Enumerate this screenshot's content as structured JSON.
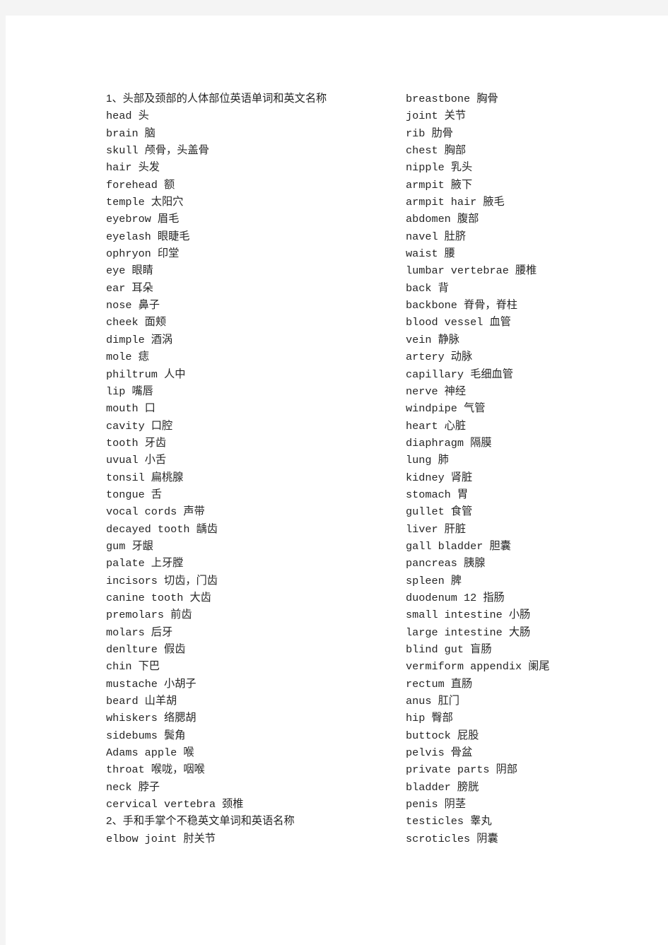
{
  "document": {
    "page_background": "#f4f4f4",
    "sheet_background": "#ffffff",
    "text_color": "#252525",
    "left_column": [
      {
        "type": "heading",
        "text": "1、头部及颈部的人体部位英语单词和英文名称"
      },
      {
        "type": "entry",
        "text": "head 头"
      },
      {
        "type": "entry",
        "text": "brain 脑"
      },
      {
        "type": "entry",
        "text": "skull 颅骨，头盖骨"
      },
      {
        "type": "entry",
        "text": "hair 头发"
      },
      {
        "type": "entry",
        "text": "forehead 额"
      },
      {
        "type": "entry",
        "text": "temple 太阳穴"
      },
      {
        "type": "entry",
        "text": "eyebrow 眉毛"
      },
      {
        "type": "entry",
        "text": "eyelash 眼睫毛"
      },
      {
        "type": "entry",
        "text": "ophryon 印堂"
      },
      {
        "type": "entry",
        "text": "eye 眼睛"
      },
      {
        "type": "entry",
        "text": "ear 耳朵"
      },
      {
        "type": "entry",
        "text": "nose 鼻子"
      },
      {
        "type": "entry",
        "text": "cheek 面颊"
      },
      {
        "type": "entry",
        "text": "dimple 酒涡"
      },
      {
        "type": "entry",
        "text": "mole 痣"
      },
      {
        "type": "entry",
        "text": "philtrum 人中"
      },
      {
        "type": "entry",
        "text": "lip 嘴唇"
      },
      {
        "type": "entry",
        "text": "mouth 口"
      },
      {
        "type": "entry",
        "text": "cavity 口腔"
      },
      {
        "type": "entry",
        "text": "tooth 牙齿"
      },
      {
        "type": "entry",
        "text": "uvual 小舌"
      },
      {
        "type": "entry",
        "text": "tonsil 扁桃腺"
      },
      {
        "type": "entry",
        "text": "tongue 舌"
      },
      {
        "type": "entry",
        "text": "vocal cords 声带"
      },
      {
        "type": "entry",
        "text": "decayed tooth 龋齿"
      },
      {
        "type": "entry",
        "text": "gum 牙龈"
      },
      {
        "type": "entry",
        "text": "palate 上牙膛"
      },
      {
        "type": "entry",
        "text": "incisors 切齿，门齿"
      },
      {
        "type": "entry",
        "text": "canine tooth 大齿"
      },
      {
        "type": "entry",
        "text": "premolars 前齿"
      },
      {
        "type": "entry",
        "text": "molars 后牙"
      },
      {
        "type": "entry",
        "text": "denlture 假齿"
      },
      {
        "type": "entry",
        "text": "chin 下巴"
      },
      {
        "type": "entry",
        "text": "mustache 小胡子"
      },
      {
        "type": "entry",
        "text": "beard 山羊胡"
      },
      {
        "type": "entry",
        "text": "whiskers 络腮胡"
      },
      {
        "type": "entry",
        "text": "sidebums 鬓角"
      },
      {
        "type": "entry",
        "text": "Adams apple 喉"
      },
      {
        "type": "entry",
        "text": "throat 喉咙，咽喉"
      },
      {
        "type": "entry",
        "text": "neck 脖子"
      },
      {
        "type": "entry",
        "text": "cervical vertebra 颈椎"
      },
      {
        "type": "heading",
        "text": "2、手和手掌个不稳英文单词和英语名称"
      },
      {
        "type": "entry",
        "text": "elbow joint 肘关节"
      }
    ],
    "right_column": [
      {
        "type": "entry",
        "text": "breastbone 胸骨"
      },
      {
        "type": "entry",
        "text": "joint 关节"
      },
      {
        "type": "entry",
        "text": "rib 肋骨"
      },
      {
        "type": "entry",
        "text": "chest 胸部"
      },
      {
        "type": "entry",
        "text": "nipple 乳头"
      },
      {
        "type": "entry",
        "text": "armpit 腋下"
      },
      {
        "type": "entry",
        "text": "armpit hair 腋毛"
      },
      {
        "type": "entry",
        "text": "abdomen 腹部"
      },
      {
        "type": "entry",
        "text": "navel 肚脐"
      },
      {
        "type": "entry",
        "text": "waist 腰"
      },
      {
        "type": "entry",
        "text": "lumbar vertebrae 腰椎"
      },
      {
        "type": "entry",
        "text": "back 背"
      },
      {
        "type": "entry",
        "text": "backbone 脊骨，脊柱"
      },
      {
        "type": "entry",
        "text": "blood vessel 血管"
      },
      {
        "type": "entry",
        "text": "vein 静脉"
      },
      {
        "type": "entry",
        "text": "artery 动脉"
      },
      {
        "type": "entry",
        "text": "capillary 毛细血管"
      },
      {
        "type": "entry",
        "text": "nerve 神经"
      },
      {
        "type": "entry",
        "text": "windpipe 气管"
      },
      {
        "type": "entry",
        "text": "heart 心脏"
      },
      {
        "type": "entry",
        "text": "diaphragm 隔膜"
      },
      {
        "type": "entry",
        "text": "lung 肺"
      },
      {
        "type": "entry",
        "text": "kidney 肾脏"
      },
      {
        "type": "entry",
        "text": "stomach 胃"
      },
      {
        "type": "entry",
        "text": "gullet 食管"
      },
      {
        "type": "entry",
        "text": "liver 肝脏"
      },
      {
        "type": "entry",
        "text": "gall bladder 胆囊"
      },
      {
        "type": "entry",
        "text": "pancreas 胰腺"
      },
      {
        "type": "entry",
        "text": "spleen 脾"
      },
      {
        "type": "entry",
        "text": "duodenum 12 指肠"
      },
      {
        "type": "entry",
        "text": "small intestine 小肠"
      },
      {
        "type": "entry",
        "text": "large intestine 大肠"
      },
      {
        "type": "entry",
        "text": "blind gut 盲肠"
      },
      {
        "type": "entry",
        "text": "vermiform appendix 阑尾"
      },
      {
        "type": "entry",
        "text": "rectum 直肠"
      },
      {
        "type": "entry",
        "text": "anus 肛门"
      },
      {
        "type": "entry",
        "text": "hip 臀部"
      },
      {
        "type": "entry",
        "text": "buttock 屁股"
      },
      {
        "type": "entry",
        "text": "pelvis 骨盆"
      },
      {
        "type": "entry",
        "text": "private parts 阴部"
      },
      {
        "type": "entry",
        "text": "bladder 膀胱"
      },
      {
        "type": "entry",
        "text": "penis 阴茎"
      },
      {
        "type": "entry",
        "text": "testicles 睾丸"
      },
      {
        "type": "entry",
        "text": "scroticles 阴囊"
      }
    ]
  }
}
